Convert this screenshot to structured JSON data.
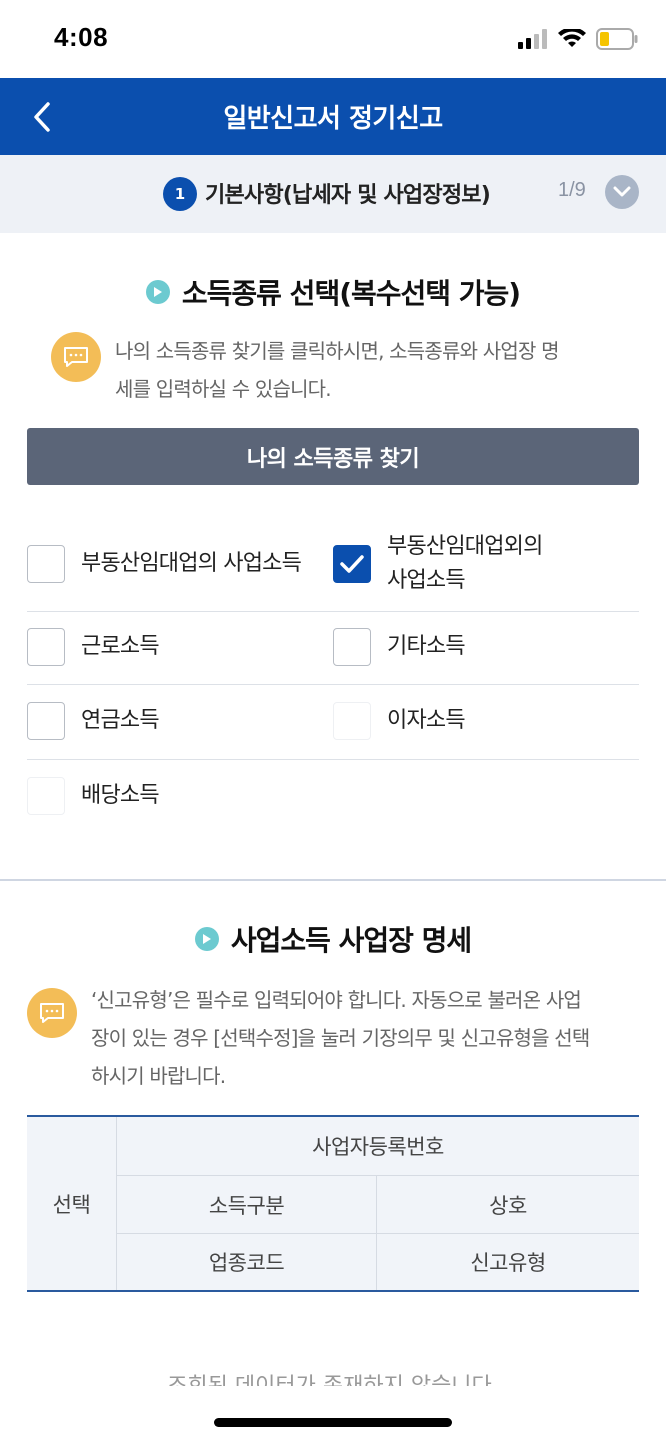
{
  "status_bar": {
    "time": "4:08"
  },
  "header": {
    "title": "일반신고서 정기신고"
  },
  "step": {
    "number": "1",
    "label": "기본사항(납세자 및 사업장정보)",
    "count": "1/9"
  },
  "income_section": {
    "title": "소득종류 선택(복수선택 가능)",
    "info_line1": "나의 소득종류 찾기를 클릭하시면, 소득종류와 사업장 명",
    "info_line2": "세를 입력하실 수 있습니다.",
    "find_button": "나의 소득종류 찾기",
    "checkboxes": [
      {
        "label": "부동산임대업의 사업소득",
        "checked": false
      },
      {
        "label_line1": "부동산임대업외의",
        "label_line2": "사업소득",
        "checked": true
      },
      {
        "label": "근로소득",
        "checked": false
      },
      {
        "label": "기타소득",
        "checked": false
      },
      {
        "label": "연금소득",
        "checked": false
      },
      {
        "label": "이자소득",
        "checked": false
      },
      {
        "label": "배당소득",
        "checked": false
      }
    ]
  },
  "business_section": {
    "title": "사업소득 사업장 명세",
    "info_line1": "‘신고유형’은 필수로 입력되어야 합니다. 자동으로 불러온 사업",
    "info_line2": "장이 있는 경우 [선택수정]을 눌러 기장의무 및 신고유형을 선택",
    "info_line3": "하시기 바랍니다.",
    "table": {
      "select": "선택",
      "reg_no": "사업자등록번호",
      "income_type": "소득구분",
      "trade_name": "상호",
      "industry_code": "업종코드",
      "report_type": "신고유형"
    },
    "empty_message": "조회된 데이터가 존재하지 않습니다."
  },
  "colors": {
    "primary": "#0b4fae",
    "button_gray": "#5b6578",
    "info_icon": "#f3bd57",
    "teal": "#6ccad0"
  }
}
